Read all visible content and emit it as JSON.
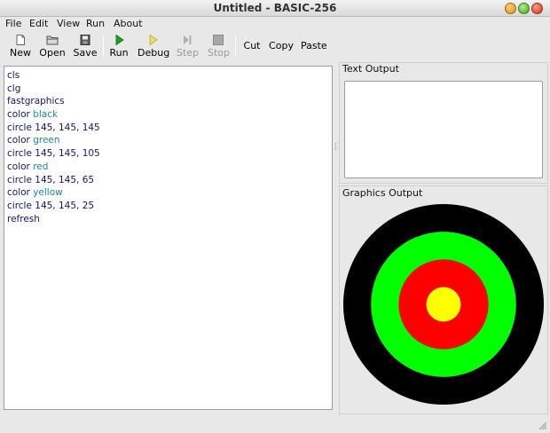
{
  "window": {
    "title": "Untitled - BASIC-256"
  },
  "menu": [
    "File",
    "Edit",
    "View",
    "Run",
    "About"
  ],
  "toolbar": {
    "new": "New",
    "open": "Open",
    "save": "Save",
    "run": "Run",
    "debug": "Debug",
    "step": "Step",
    "stop": "Stop",
    "cut": "Cut",
    "copy": "Copy",
    "paste": "Paste"
  },
  "editor": {
    "lines": [
      [
        {
          "t": "cls",
          "c": "kw"
        }
      ],
      [
        {
          "t": "clg",
          "c": "kw"
        }
      ],
      [
        {
          "t": "fastgraphics",
          "c": "kw"
        }
      ],
      [
        {
          "t": "color ",
          "c": "kw"
        },
        {
          "t": "black",
          "c": "str"
        }
      ],
      [
        {
          "t": "circle 145, 145, 145",
          "c": "kw"
        }
      ],
      [
        {
          "t": "color ",
          "c": "kw"
        },
        {
          "t": "green",
          "c": "str"
        }
      ],
      [
        {
          "t": "circle 145, 145, 105",
          "c": "kw"
        }
      ],
      [
        {
          "t": "color ",
          "c": "kw"
        },
        {
          "t": "red",
          "c": "str"
        }
      ],
      [
        {
          "t": "circle 145, 145, 65",
          "c": "kw"
        }
      ],
      [
        {
          "t": "color ",
          "c": "kw"
        },
        {
          "t": "yellow",
          "c": "str"
        }
      ],
      [
        {
          "t": "circle 145, 145, 25",
          "c": "kw"
        }
      ],
      [
        {
          "t": "refresh",
          "c": "kw"
        }
      ]
    ]
  },
  "panels": {
    "text_output": "Text Output",
    "graphics_output": "Graphics Output"
  },
  "graphics": {
    "circles": [
      {
        "color": "#000000",
        "r": 145
      },
      {
        "color": "#00ff00",
        "r": 105
      },
      {
        "color": "#ff0000",
        "r": 65
      },
      {
        "color": "#ffff00",
        "r": 25
      }
    ]
  }
}
